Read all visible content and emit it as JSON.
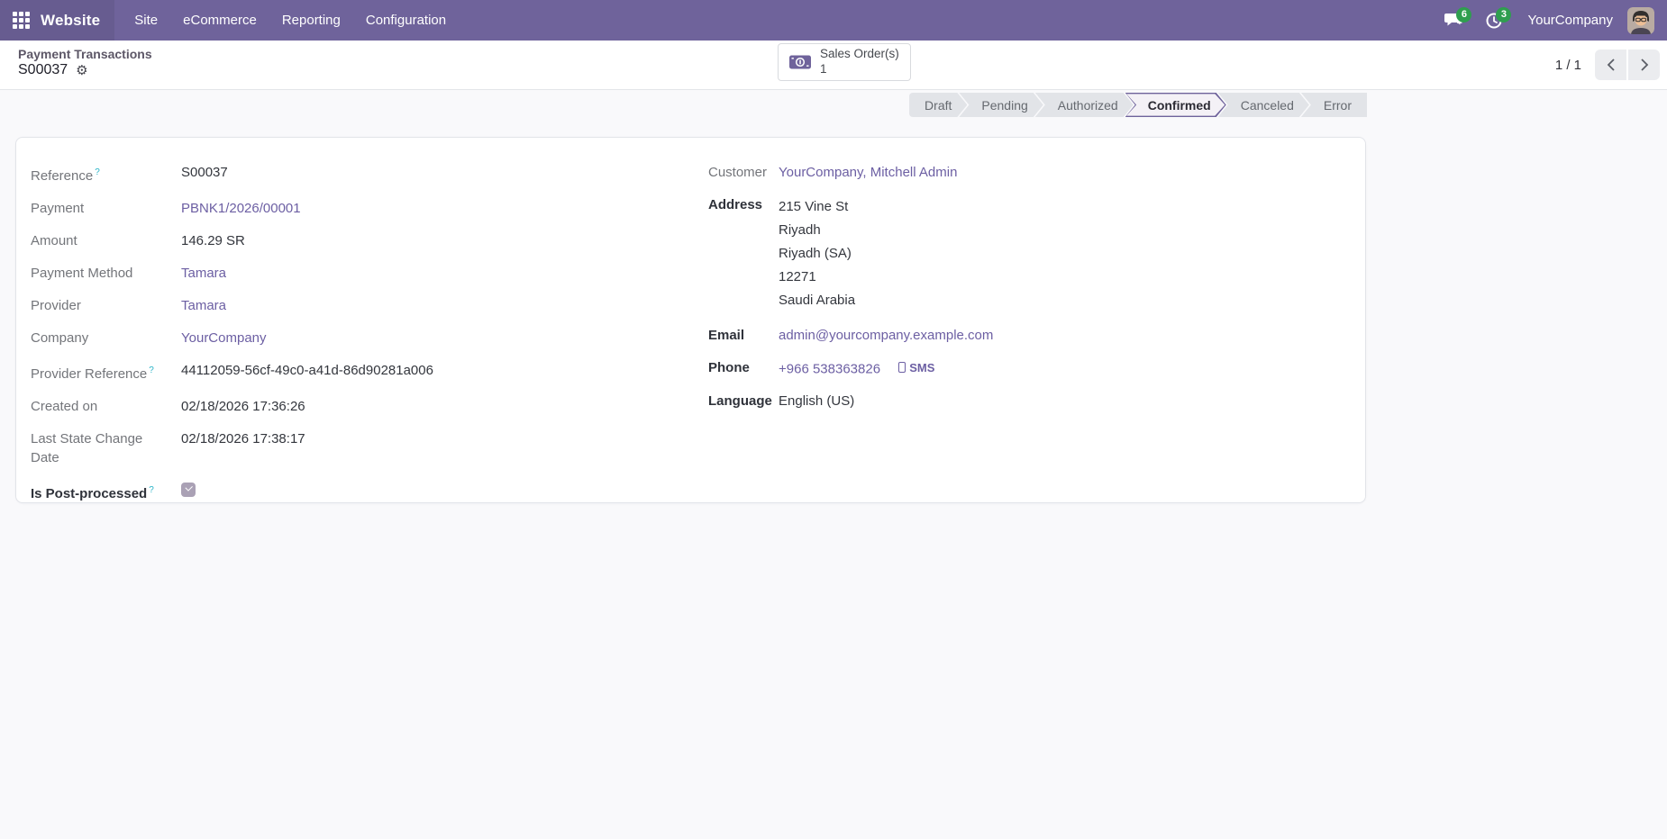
{
  "topbar": {
    "app_name": "Website",
    "menus": [
      "Site",
      "eCommerce",
      "Reporting",
      "Configuration"
    ],
    "messages_badge": "6",
    "activities_badge": "3",
    "user_company": "YourCompany"
  },
  "control_panel": {
    "breadcrumb_parent": "Payment Transactions",
    "record_name": "S00037",
    "smart_button": {
      "label": "Sales Order(s)",
      "count": "1"
    },
    "pager_value": "1 / 1"
  },
  "statusbar": {
    "steps": [
      {
        "label": "Draft"
      },
      {
        "label": "Pending"
      },
      {
        "label": "Authorized"
      },
      {
        "label": "Confirmed",
        "active": true
      },
      {
        "label": "Canceled"
      },
      {
        "label": "Error"
      }
    ]
  },
  "form": {
    "left_rows": [
      {
        "label": "Reference",
        "help": "?",
        "value": "S00037"
      },
      {
        "label": "Payment",
        "value": "PBNK1/2026/00001"
      },
      {
        "label": "Amount",
        "value": "146.29 SR"
      },
      {
        "label": "Payment Method",
        "value": "Tamara"
      },
      {
        "label": "Provider",
        "value": "Tamara"
      },
      {
        "label": "Company",
        "value": "YourCompany"
      },
      {
        "label": "Provider Reference",
        "help": "?",
        "value": "44112059-56cf-49c0-a41d-86d90281a006"
      },
      {
        "label": "Created on",
        "value": "02/18/2026 17:36:26"
      },
      {
        "label": "Last State Change Date",
        "value": "02/18/2026 17:38:17"
      },
      {
        "label": "Is Post-processed",
        "help": "?",
        "checked": true
      }
    ],
    "right": {
      "customer": {
        "label": "Customer",
        "value": "YourCompany, Mitchell Admin"
      },
      "address": {
        "label": "Address",
        "lines": [
          "215 Vine St",
          "Riyadh",
          "Riyadh (SA)",
          "12271",
          "Saudi Arabia"
        ]
      },
      "email": {
        "label": "Email",
        "value": "admin@yourcompany.example.com"
      },
      "phone": {
        "label": "Phone",
        "value": "+966 538363826",
        "sms_label": "SMS"
      },
      "language": {
        "label": "Language",
        "value": "English (US)"
      }
    }
  },
  "colors": {
    "topbar": "#6F639B",
    "link": "#6C5FA3",
    "badge_green": "#2F9E4F",
    "active_step_border": "#6F639B",
    "help_marker": "#29B3C7"
  }
}
